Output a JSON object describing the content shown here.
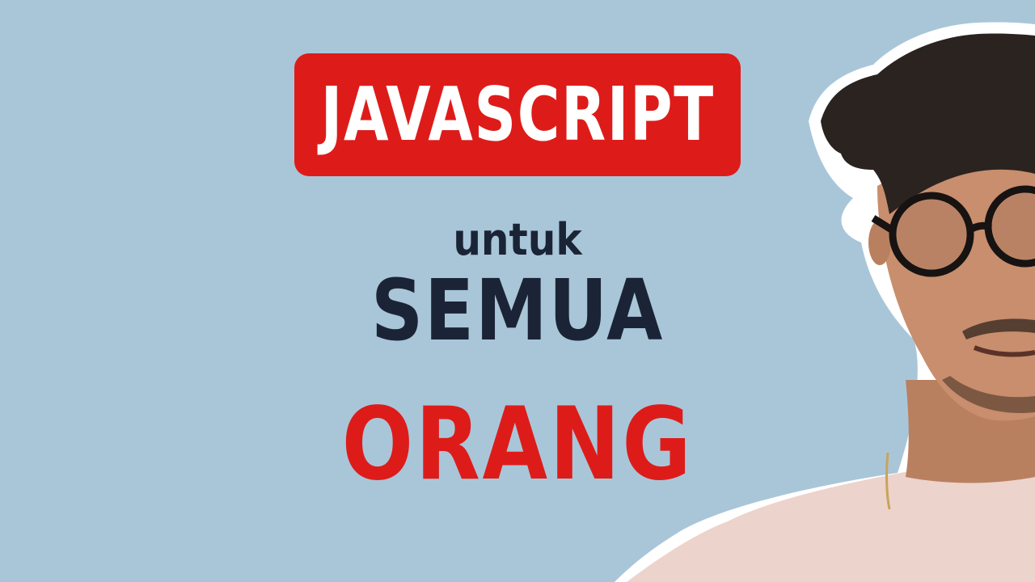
{
  "thumbnail": {
    "title_badge": "JAVASCRIPT",
    "line1": "untuk",
    "line2": "SEMUA",
    "line3": "ORANG"
  },
  "colors": {
    "background": "#a9c6d9",
    "accent_red": "#dd1c1a",
    "dark_navy": "#1b2436",
    "white": "#ffffff"
  }
}
